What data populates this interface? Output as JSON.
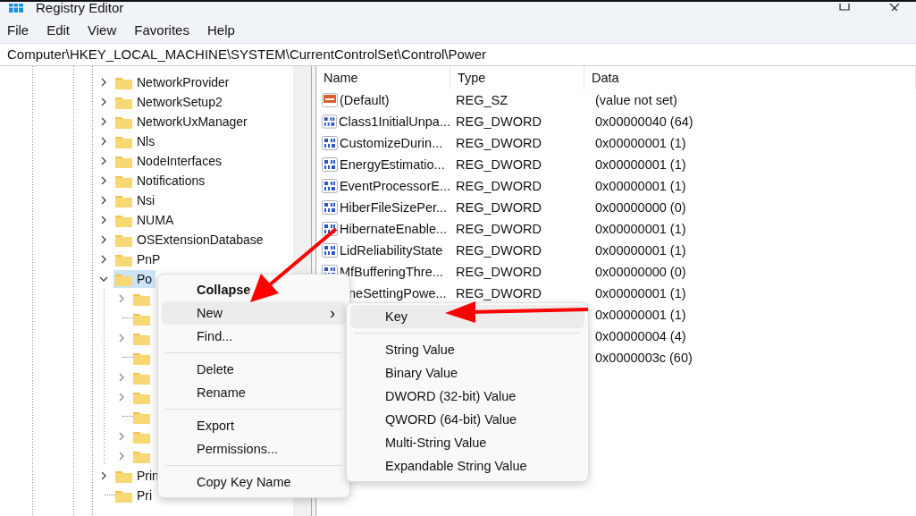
{
  "window": {
    "title": "Registry Editor"
  },
  "menu_bar": [
    "File",
    "Edit",
    "View",
    "Favorites",
    "Help"
  ],
  "address": "Computer\\HKEY_LOCAL_MACHINE\\SYSTEM\\CurrentControlSet\\Control\\Power",
  "tree": [
    {
      "name": "NetworkProvider",
      "expandable": true,
      "expanded": false,
      "selected": false
    },
    {
      "name": "NetworkSetup2",
      "expandable": true,
      "expanded": false,
      "selected": false
    },
    {
      "name": "NetworkUxManager",
      "expandable": true,
      "expanded": false,
      "selected": false
    },
    {
      "name": "Nls",
      "expandable": true,
      "expanded": false,
      "selected": false
    },
    {
      "name": "NodeInterfaces",
      "expandable": true,
      "expanded": false,
      "selected": false
    },
    {
      "name": "Notifications",
      "expandable": true,
      "expanded": false,
      "selected": false
    },
    {
      "name": "Nsi",
      "expandable": true,
      "expanded": false,
      "selected": false
    },
    {
      "name": "NUMA",
      "expandable": true,
      "expanded": false,
      "selected": false
    },
    {
      "name": "OSExtensionDatabase",
      "expandable": true,
      "expanded": false,
      "selected": false
    },
    {
      "name": "PnP",
      "expandable": true,
      "expanded": false,
      "selected": false
    },
    {
      "name": "Po",
      "expandable": true,
      "expanded": true,
      "selected": true,
      "children": [
        {
          "expandable": true,
          "expanded": false,
          "selected": false
        },
        {
          "expandable": false,
          "selected": false
        },
        {
          "expandable": true,
          "expanded": false,
          "selected": false
        },
        {
          "expandable": false,
          "selected": false
        },
        {
          "expandable": true,
          "expanded": false,
          "selected": false
        },
        {
          "expandable": true,
          "expanded": false,
          "selected": false
        },
        {
          "expandable": false,
          "selected": false
        },
        {
          "expandable": true,
          "expanded": false,
          "selected": false
        },
        {
          "expandable": true,
          "expanded": false,
          "selected": false
        }
      ]
    },
    {
      "name": "Prin",
      "expandable": true,
      "expanded": false,
      "selected": false
    },
    {
      "name": "Pri",
      "expandable": false,
      "selected": false
    }
  ],
  "values": {
    "columns": [
      "Name",
      "Type",
      "Data"
    ],
    "rows": [
      {
        "kind": "string",
        "name": "(Default)",
        "type": "REG_SZ",
        "data": "(value not set)"
      },
      {
        "kind": "dword",
        "name": "Class1InitialUnpa...",
        "type": "REG_DWORD",
        "data": "0x00000040 (64)"
      },
      {
        "kind": "dword",
        "name": "CustomizeDurin...",
        "type": "REG_DWORD",
        "data": "0x00000001 (1)"
      },
      {
        "kind": "dword",
        "name": "EnergyEstimatio...",
        "type": "REG_DWORD",
        "data": "0x00000001 (1)"
      },
      {
        "kind": "dword",
        "name": "EventProcessorE...",
        "type": "REG_DWORD",
        "data": "0x00000001 (1)"
      },
      {
        "kind": "dword",
        "name": "HiberFileSizePer...",
        "type": "REG_DWORD",
        "data": "0x00000000 (0)"
      },
      {
        "kind": "dword",
        "name": "HibernateEnable...",
        "type": "REG_DWORD",
        "data": "0x00000001 (1)"
      },
      {
        "kind": "dword",
        "name": "LidReliabilityState",
        "type": "REG_DWORD",
        "data": "0x00000001 (1)"
      },
      {
        "kind": "dword",
        "name": "MfBufferingThre...",
        "type": "REG_DWORD",
        "data": "0x00000000 (0)"
      },
      {
        "name": "neSettingPowe...",
        "type": "REG_DWORD",
        "data": "0x00000001 (1)"
      },
      {
        "data": "0x00000001 (1)"
      },
      {
        "data": "0x00000004 (4)"
      },
      {
        "data": "0x0000003c (60)"
      }
    ]
  },
  "context_menu": [
    {
      "kind": "item",
      "label": "Collapse",
      "bold": true,
      "selected": false
    },
    {
      "kind": "submenu",
      "label": "New",
      "chevron": "›",
      "selected": true
    },
    {
      "kind": "item",
      "label": "Find...",
      "selected": false
    },
    {
      "kind": "separator"
    },
    {
      "kind": "item",
      "label": "Delete",
      "selected": false
    },
    {
      "kind": "item",
      "label": "Rename",
      "selected": false
    },
    {
      "kind": "separator"
    },
    {
      "kind": "item",
      "label": "Export",
      "selected": false
    },
    {
      "kind": "item",
      "label": "Permissions...",
      "selected": false
    },
    {
      "kind": "separator"
    },
    {
      "kind": "item",
      "label": "Copy Key Name",
      "selected": false
    }
  ],
  "submenu": [
    {
      "kind": "item",
      "label": "Key",
      "selected": true
    },
    {
      "kind": "separator"
    },
    {
      "kind": "item",
      "label": "String Value",
      "selected": false
    },
    {
      "kind": "item",
      "label": "Binary Value",
      "selected": false
    },
    {
      "kind": "item",
      "label": "DWORD (32-bit) Value",
      "selected": false
    },
    {
      "kind": "item",
      "label": "QWORD (64-bit) Value",
      "selected": false
    },
    {
      "kind": "item",
      "label": "Multi-String Value",
      "selected": false
    },
    {
      "kind": "item",
      "label": "Expandable String Value",
      "selected": false
    }
  ]
}
